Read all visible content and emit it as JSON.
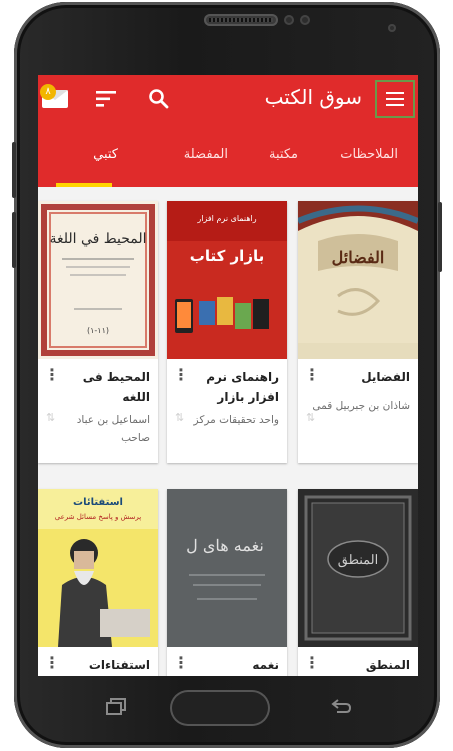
{
  "app": {
    "title": "سوق الكتب",
    "notification_count": "٨"
  },
  "tabs": [
    {
      "label": "الملاحظات"
    },
    {
      "label": "مكتبة"
    },
    {
      "label": "المفضلة"
    },
    {
      "label": "كتبي",
      "active": true
    }
  ],
  "books": [
    {
      "title": "الفضايل",
      "author": "شاذان بن جبربيل قمی",
      "cover_text": "الفضائل"
    },
    {
      "title": "راهنمای نرم افزار بازار",
      "author": "واحد تحقیقات مرکز",
      "cover_text": "بازار کتاب"
    },
    {
      "title": "المحيط فی اللغه",
      "author": "اسماعیل بن عباد صاحب",
      "cover_text": "المحيط في اللغة"
    },
    {
      "title": "المنطق",
      "author": "",
      "cover_text": "المنطق"
    },
    {
      "title": "نغمه",
      "author": "",
      "cover_text": "نغمه های ل"
    },
    {
      "title": "استفتاءات",
      "author": "",
      "cover_text": "استفتائات"
    }
  ],
  "colors": {
    "primary": "#e02b2b",
    "tab_indicator": "#ffd400",
    "badge": "#f2b600"
  },
  "icons": {
    "menu": "hamburger-icon",
    "search": "search-icon",
    "sort": "sort-icon",
    "mail": "mail-icon",
    "more": "more-vert-icon"
  }
}
